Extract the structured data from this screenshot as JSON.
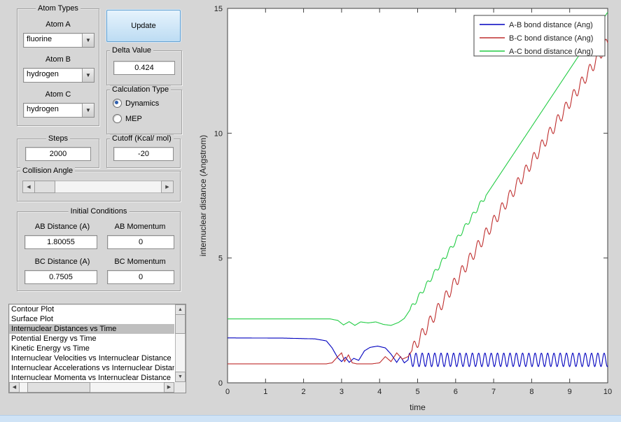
{
  "window": {
    "bg_color": "#d6d6d6",
    "bottom_bar_color": "#cfe3f6"
  },
  "controls": {
    "atom_types": {
      "title": "Atom Types",
      "fields": [
        {
          "label": "Atom A",
          "value": "fluorine"
        },
        {
          "label": "Atom B",
          "value": "hydrogen"
        },
        {
          "label": "Atom C",
          "value": "hydrogen"
        }
      ]
    },
    "update_button": {
      "label": "Update"
    },
    "delta": {
      "title": "Delta Value",
      "value": "0.424"
    },
    "calc_type": {
      "title": "Calculation Type",
      "options": [
        {
          "label": "Dynamics",
          "selected": true
        },
        {
          "label": "MEP",
          "selected": false
        }
      ]
    },
    "steps": {
      "title": "Steps",
      "value": "2000"
    },
    "cutoff": {
      "title": "Cutoff (Kcal/ mol)",
      "value": "-20"
    },
    "collision": {
      "title": "Collision Angle"
    },
    "initial": {
      "title": "Initial Conditions",
      "fields": [
        {
          "label": "AB Distance (A)",
          "value": "1.80055"
        },
        {
          "label": "AB Momentum",
          "value": "0"
        },
        {
          "label": "BC Distance (A)",
          "value": "0.7505"
        },
        {
          "label": "BC Momentum",
          "value": "0"
        }
      ]
    },
    "plot_list": {
      "selected_index": 2,
      "items": [
        "Contour Plot",
        "Surface Plot",
        "Internuclear Distances vs Time",
        "Potential Energy vs Time",
        "Kinetic Energy vs Time",
        "Internuclear Velocities vs Internuclear Distance",
        "Internuclear Accelerations vs Internuclear Distance",
        "Internuclear Momenta vs Internuclear Distance"
      ]
    }
  },
  "chart_data": {
    "type": "line",
    "title": "",
    "xlabel": "time",
    "ylabel": "internuclear distance (Angstrom)",
    "xlim": [
      0,
      10
    ],
    "ylim": [
      0,
      15
    ],
    "xticks": [
      0,
      1,
      2,
      3,
      4,
      5,
      6,
      7,
      8,
      9,
      10
    ],
    "yticks": [
      0,
      5,
      10,
      15
    ],
    "grid": false,
    "plot_bg": "#ffffff",
    "axis_color": "#404040",
    "sample_dt": 0.01,
    "legend": {
      "position": "top-right",
      "entries": [
        "A-B bond distance (Ang)",
        "B-C bond distance (Ang)",
        "A-C bond distance (Ang)"
      ]
    },
    "series": [
      {
        "name": "A-B bond distance (Ang)",
        "color": "#0000bf",
        "base_points": [
          [
            0,
            1.8
          ],
          [
            1.5,
            1.79
          ],
          [
            2.3,
            1.76
          ],
          [
            2.6,
            1.68
          ],
          [
            2.75,
            1.4
          ],
          [
            2.9,
            1.0
          ],
          [
            3.0,
            0.85
          ],
          [
            3.1,
            1.02
          ],
          [
            3.2,
            0.82
          ],
          [
            3.32,
            0.98
          ],
          [
            3.45,
            0.9
          ],
          [
            3.6,
            1.28
          ],
          [
            3.75,
            1.42
          ],
          [
            3.95,
            1.47
          ],
          [
            4.15,
            1.4
          ],
          [
            4.3,
            1.15
          ],
          [
            4.45,
            0.82
          ],
          [
            4.55,
            1.05
          ],
          [
            4.65,
            0.8
          ],
          [
            4.75,
            0.92
          ],
          [
            10,
            0.92
          ]
        ],
        "oscillations": [
          {
            "t0": 4.75,
            "t1": 10,
            "amp": 0.27,
            "period": 0.165
          }
        ]
      },
      {
        "name": "B-C bond distance (Ang)",
        "color": "#bf2e2e",
        "base_points": [
          [
            0,
            0.76
          ],
          [
            2.6,
            0.76
          ],
          [
            2.75,
            0.8
          ],
          [
            2.9,
            1.05
          ],
          [
            3.0,
            1.2
          ],
          [
            3.08,
            0.85
          ],
          [
            3.18,
            1.12
          ],
          [
            3.28,
            0.8
          ],
          [
            3.4,
            0.76
          ],
          [
            3.8,
            0.76
          ],
          [
            4.0,
            0.8
          ],
          [
            4.15,
            1.05
          ],
          [
            4.3,
            0.85
          ],
          [
            4.45,
            1.2
          ],
          [
            4.6,
            0.95
          ],
          [
            4.75,
            1.05
          ],
          [
            10,
            13.65
          ]
        ],
        "oscillations": [
          {
            "t0": 4.85,
            "t1": 10,
            "amp": 0.24,
            "period": 0.21
          }
        ]
      },
      {
        "name": "A-C bond distance (Ang)",
        "color": "#22cc44",
        "base_points": [
          [
            0,
            2.56
          ],
          [
            2.7,
            2.56
          ],
          [
            2.9,
            2.5
          ],
          [
            3.05,
            2.32
          ],
          [
            3.2,
            2.45
          ],
          [
            3.35,
            2.3
          ],
          [
            3.5,
            2.44
          ],
          [
            3.7,
            2.4
          ],
          [
            3.9,
            2.44
          ],
          [
            4.1,
            2.34
          ],
          [
            4.3,
            2.3
          ],
          [
            4.5,
            2.42
          ],
          [
            4.65,
            2.58
          ],
          [
            10,
            14.85
          ]
        ],
        "oscillations": [
          {
            "t0": 4.8,
            "t1": 6.8,
            "amp": 0.1,
            "period": 0.2
          }
        ]
      }
    ]
  }
}
